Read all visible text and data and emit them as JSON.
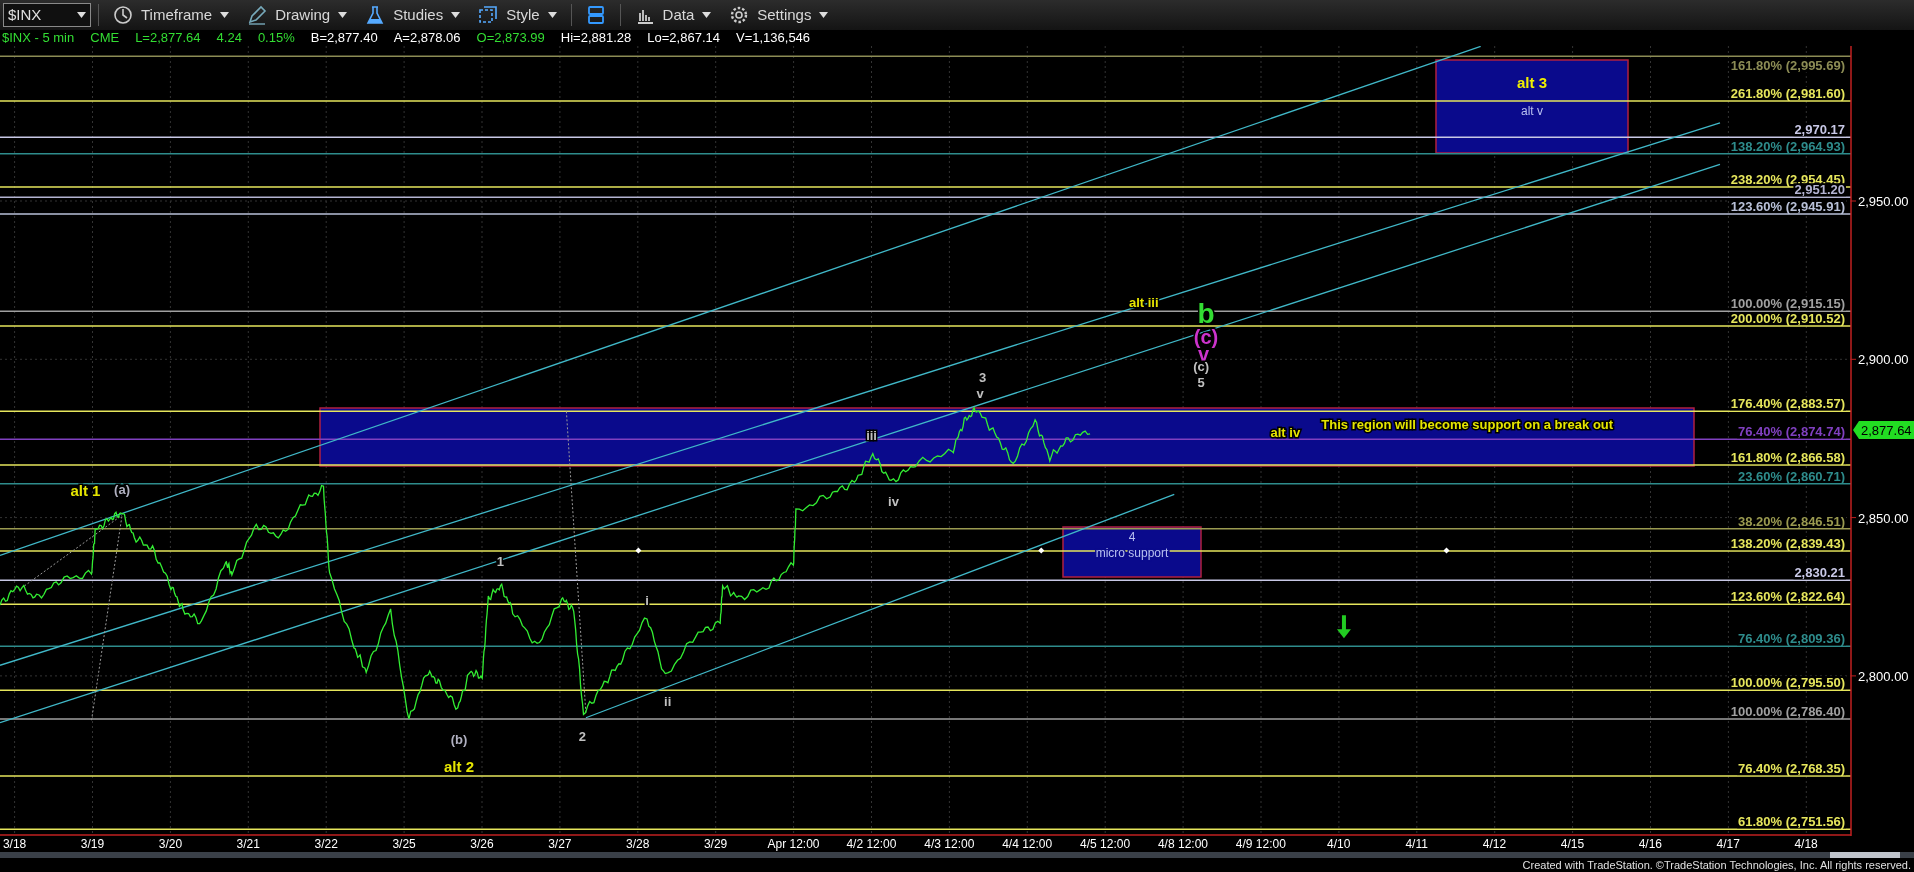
{
  "toolbar": {
    "symbol": "$INX",
    "items": [
      {
        "kind": "menu",
        "label": "Timeframe"
      },
      {
        "kind": "menu",
        "label": "Drawing"
      },
      {
        "kind": "menu",
        "label": "Studies"
      },
      {
        "kind": "menu",
        "label": "Style"
      },
      {
        "kind": "icon"
      },
      {
        "kind": "menu",
        "label": "Data"
      },
      {
        "kind": "menu",
        "label": "Settings"
      }
    ]
  },
  "quote_line": [
    {
      "text": "$INX - 5 min",
      "color": "#33dd33"
    },
    {
      "text": "CME",
      "color": "#33dd33"
    },
    {
      "text": "L=2,877.64",
      "color": "#33dd33"
    },
    {
      "text": "4.24",
      "color": "#33dd33"
    },
    {
      "text": "0.15%",
      "color": "#33dd33"
    },
    {
      "text": "B=2,877.40",
      "color": "#ffffff"
    },
    {
      "text": "A=2,878.06",
      "color": "#ffffff"
    },
    {
      "text": "O=2,873.99",
      "color": "#33dd33"
    },
    {
      "text": "Hi=2,881.28",
      "color": "#ffffff"
    },
    {
      "text": "Lo=2,867.14",
      "color": "#ffffff"
    },
    {
      "text": "V=1,136,546",
      "color": "#ffffff"
    }
  ],
  "chart": {
    "levels": [
      {
        "label": "161.80% (2,995.69)",
        "color": "#8c8c55"
      },
      {
        "label": "261.80% (2,981.60)",
        "color": "#e6e65c"
      },
      {
        "label": "2,970.17",
        "color": "#c8c8e6"
      },
      {
        "label": "138.20% (2,964.93)",
        "color": "#2e8c8c"
      },
      {
        "label": "238.20% (2,954.45)",
        "color": "#e6e65c"
      },
      {
        "label": "2,951.20",
        "color": "#b4b4d2"
      },
      {
        "label": "123.60% (2,945.91)",
        "color": "#b8c0d8"
      },
      {
        "label": "100.00% (2,915.15)",
        "color": "#a0a0a0"
      },
      {
        "label": "200.00% (2,910.52)",
        "color": "#e6e65c"
      },
      {
        "label": "176.40% (2,883.57)",
        "color": "#e6e65c"
      },
      {
        "label": "76.40% (2,874.74)",
        "color": "#8040c0"
      },
      {
        "label": "161.80% (2,866.58)",
        "color": "#e6e65c"
      },
      {
        "label": "23.60% (2,860.71)",
        "color": "#2e8c8c"
      },
      {
        "label": "38.20% (2,846.51)",
        "color": "#9a9a50"
      },
      {
        "label": "138.20% (2,839.43)",
        "color": "#e6e65c"
      },
      {
        "label": "2,830.21",
        "color": "#c8c8e6"
      },
      {
        "label": "123.60% (2,822.64)",
        "color": "#e6e65c"
      },
      {
        "label": "76.40% (2,809.36)",
        "color": "#2e8c8c"
      },
      {
        "label": "100.00% (2,795.50)",
        "color": "#e6e65c"
      },
      {
        "label": "100.00% (2,786.40)",
        "color": "#a0a0a0"
      },
      {
        "label": "76.40% (2,768.35)",
        "color": "#e6e65c"
      },
      {
        "label": "61.80% (2,751.56)",
        "color": "#e6e65c"
      }
    ],
    "zones": [
      {
        "kind": "labeled",
        "lines": [
          "alt 3",
          "alt v"
        ]
      },
      {
        "kind": "plain"
      },
      {
        "kind": "labeled",
        "lines": [
          "4",
          "micro support"
        ]
      }
    ],
    "annotations": [
      {
        "text": "alt 1",
        "color": "#e6e600"
      },
      {
        "text": "(a)",
        "color": "#b0b0c0"
      },
      {
        "text": "1",
        "color": "#c0c0c0"
      },
      {
        "text": "(b)",
        "color": "#b0b0c0"
      },
      {
        "text": "alt 2",
        "color": "#e6e600"
      },
      {
        "text": "2",
        "color": "#c0c0c0"
      },
      {
        "text": "i",
        "color": "#c0c0c0"
      },
      {
        "text": "ii",
        "color": "#c0c0c0"
      },
      {
        "text": "iii",
        "color": "#c0c0c0"
      },
      {
        "text": "iv",
        "color": "#c0c0c0"
      },
      {
        "text": "3",
        "color": "#c0c0c0"
      },
      {
        "text": "v",
        "color": "#c0c0c0"
      },
      {
        "text": "alt iii",
        "color": "#e6e600"
      },
      {
        "text": "b",
        "color": "#33dd33"
      },
      {
        "text": "(c)",
        "color": "#cc33cc"
      },
      {
        "text": "v",
        "color": "#cc33cc"
      },
      {
        "text": "(c)",
        "color": "#c0c0c0"
      },
      {
        "text": "5",
        "color": "#c0c0c0"
      },
      {
        "text": "alt iv",
        "color": "#e6e600"
      },
      {
        "text": "This region will become support on a break out",
        "color": "#e6e600"
      }
    ],
    "price_axis": {
      "ticks": [
        "2,950.00",
        "2,900.00",
        "2,850.00",
        "2,800.00"
      ],
      "last_price": "2,877.64"
    },
    "date_axis": [
      "3/18",
      "3/19",
      "3/20",
      "3/21",
      "3/22",
      "3/25",
      "3/26",
      "3/27",
      "3/28",
      "3/29",
      "Apr 12:00",
      "4/2 12:00",
      "4/3 12:00",
      "4/4 12:00",
      "4/5 12:00",
      "4/8 12:00",
      "4/9 12:00",
      "4/10",
      "4/11",
      "4/12",
      "4/15",
      "4/16",
      "4/17",
      "4/18"
    ]
  },
  "footer": "Created with TradeStation. ©TradeStation Technologies, Inc. All rights reserved."
}
